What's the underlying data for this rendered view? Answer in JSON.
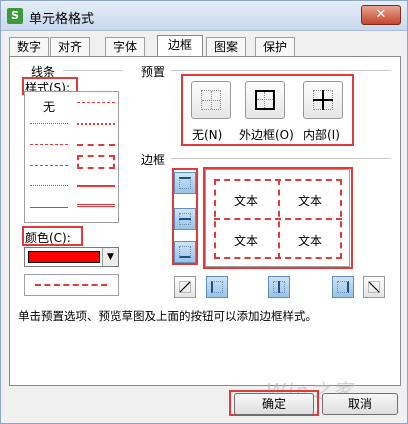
{
  "window": {
    "title": "单元格格式",
    "app_icon_glyph": "S",
    "close_glyph": "✕"
  },
  "tabs": [
    {
      "label": "数字"
    },
    {
      "label": "对齐"
    },
    {
      "label": "字体"
    },
    {
      "label": "边框"
    },
    {
      "label": "图案"
    },
    {
      "label": "保护"
    }
  ],
  "line": {
    "group_label": "线条",
    "style_label": "样式(S):",
    "none_label": "无",
    "color_label": "颜色(C):",
    "color_value": "#ff0000"
  },
  "presets": {
    "group_label": "预置",
    "items": [
      {
        "label": "无(N)"
      },
      {
        "label": "外边框(O)"
      },
      {
        "label": "内部(I)"
      }
    ]
  },
  "border": {
    "group_label": "边框",
    "preview_cells": [
      "文本",
      "文本",
      "文本",
      "文本"
    ]
  },
  "hint": "单击预置选项、预览草图及上面的按钮可以添加边框样式。",
  "buttons": {
    "ok": "确定",
    "cancel": "取消"
  },
  "watermark": "Win之家",
  "accent_color": "#e23a3a"
}
